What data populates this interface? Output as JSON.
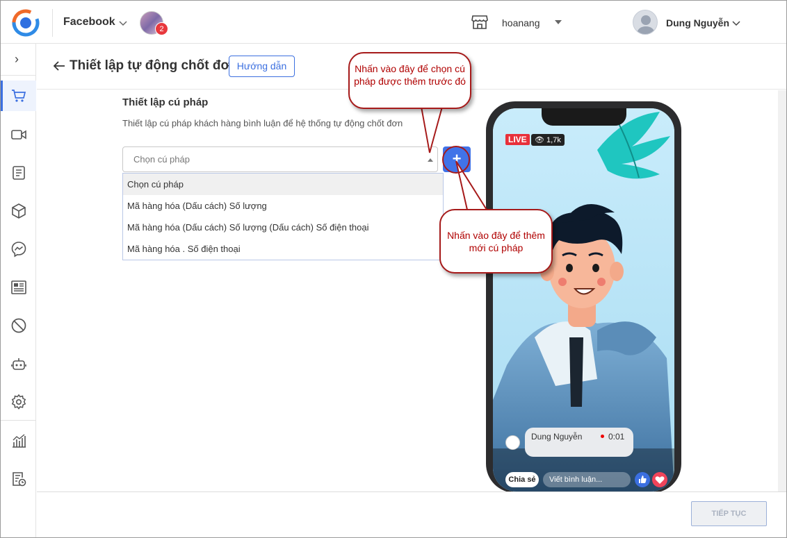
{
  "topbar": {
    "channel": "Facebook",
    "notification_count": "2",
    "store_name": "hoanang",
    "user_name": "Dung Nguyễn"
  },
  "sidebar": {
    "items": [
      {
        "icon": "cart-icon",
        "active": true
      },
      {
        "icon": "video-icon",
        "active": false
      },
      {
        "icon": "document-icon",
        "active": false
      },
      {
        "icon": "box-icon",
        "active": false
      },
      {
        "icon": "messenger-icon",
        "active": false
      },
      {
        "icon": "profile-card-icon",
        "active": false
      },
      {
        "icon": "block-icon",
        "active": false
      },
      {
        "icon": "bot-icon",
        "active": false
      },
      {
        "icon": "gear-icon",
        "active": false
      },
      {
        "icon": "chart-icon",
        "active": false
      },
      {
        "icon": "report-clock-icon",
        "active": false
      }
    ]
  },
  "header": {
    "title": "Thiết lập tự động chốt đơn",
    "guide_label": "Hướng dẫn"
  },
  "syntax": {
    "title": "Thiết lập cú pháp",
    "description": "Thiết lập cú pháp khách hàng bình luận để hệ thống tự động chốt đơn",
    "placeholder": "Chọn cú pháp",
    "add_label": "+",
    "options": [
      "Chọn cú pháp",
      "Mã hàng hóa (Dấu cách) Số lượng",
      "Mã hàng hóa (Dấu cách) Số lượng (Dấu cách) Số điện thoại",
      "Mã hàng hóa . Số điện thoại"
    ]
  },
  "callouts": {
    "select_hint": "Nhấn vào đây để chọn cú pháp  được thêm trước đó",
    "add_hint": "Nhấn vào đây để thêm mới cú pháp"
  },
  "phone": {
    "live_label": "LIVE",
    "viewers": "1,7k",
    "comment_name": "Dung Nguyễn",
    "comment_time": "0:01",
    "share_label": "Chia sẻ",
    "comment_placeholder": "Viết bình luận..."
  },
  "footer": {
    "next_label": "TIẾP TỤC"
  },
  "colors": {
    "accent": "#3b6fe0",
    "callout_text": "#b00000",
    "live": "#e8303a"
  }
}
